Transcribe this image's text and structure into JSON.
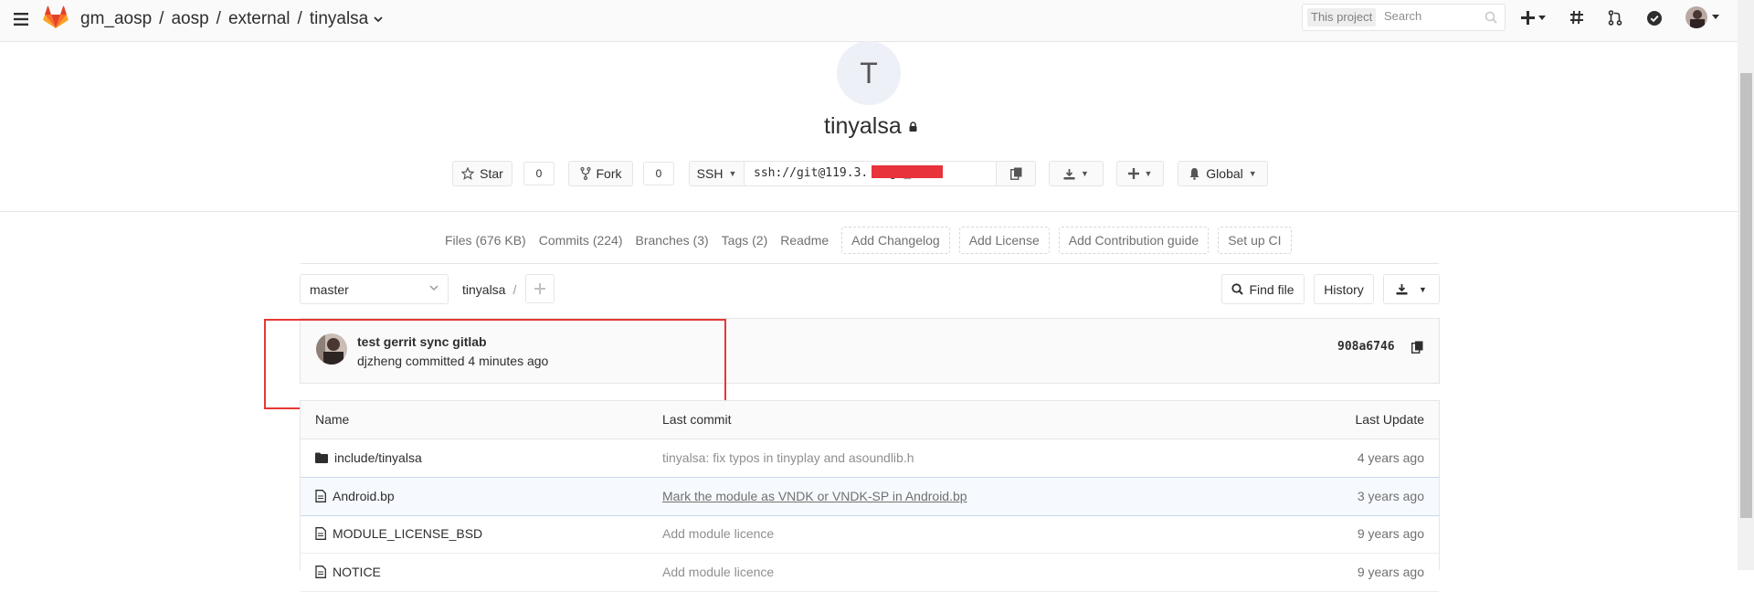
{
  "topnav": {
    "breadcrumb": [
      "gm_aosp",
      "aosp",
      "external",
      "tinyalsa"
    ],
    "search_scope": "This project",
    "search_placeholder": "Search"
  },
  "project": {
    "avatar_letter": "T",
    "name": "tinyalsa",
    "star_label": "Star",
    "star_count": "0",
    "fork_label": "Fork",
    "fork_count": "0",
    "protocol": "SSH",
    "clone_url": "ssh://git@119.3.                  2/gm_a",
    "notification_level": "Global"
  },
  "project_nav": {
    "links": [
      "Files (676 KB)",
      "Commits (224)",
      "Branches (3)",
      "Tags (2)",
      "Readme"
    ],
    "dashed_links": [
      "Add Changelog",
      "Add License",
      "Add Contribution guide",
      "Set up CI"
    ]
  },
  "tree": {
    "branch": "master",
    "path_root": "tinyalsa",
    "path_sep": "/",
    "find_file_label": "Find file",
    "history_label": "History"
  },
  "last_commit": {
    "title": "test gerrit sync gitlab",
    "meta": "djzheng committed 4 minutes ago",
    "sha": "908a6746"
  },
  "files": {
    "headers": [
      "Name",
      "Last commit",
      "Last Update"
    ],
    "rows": [
      {
        "name": "include/tinyalsa",
        "type": "folder",
        "commit": "tinyalsa: fix typos in tinyplay and asoundlib.h",
        "updated": "4 years ago"
      },
      {
        "name": "Android.bp",
        "type": "file",
        "commit": "Mark the module as VNDK or VNDK-SP in Android.bp",
        "updated": "3 years ago"
      },
      {
        "name": "MODULE_LICENSE_BSD",
        "type": "file",
        "commit": "Add module licence",
        "updated": "9 years ago"
      },
      {
        "name": "NOTICE",
        "type": "file",
        "commit": "Add module licence",
        "updated": "9 years ago"
      }
    ]
  },
  "colors": {
    "brand_orange": "#fc6d26",
    "highlight_red": "#e53935",
    "redaction_red": "#e8323c"
  }
}
